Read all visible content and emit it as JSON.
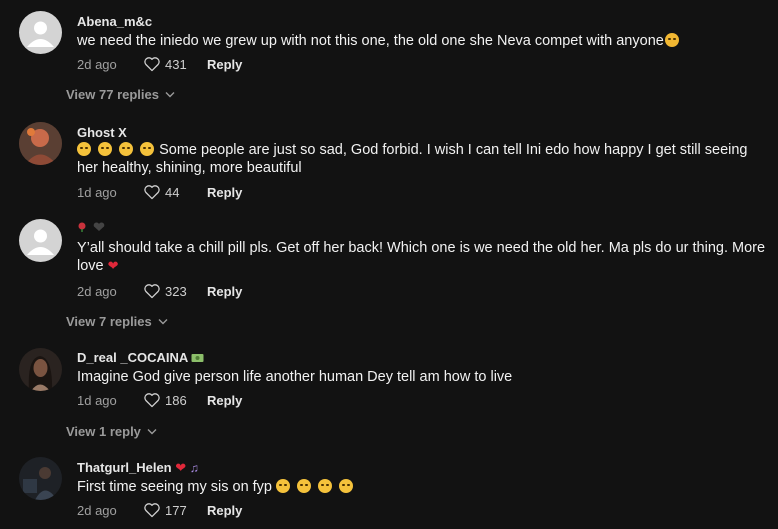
{
  "comments": [
    {
      "username": "Abena_m&c",
      "text": "we need the iniedo we grew up with not this one, the old one she Neva compet with anyone",
      "ago": "2d ago",
      "likes": "431",
      "reply": "Reply",
      "view_replies": "View 77 replies"
    },
    {
      "username": "Ghost X",
      "text": "Some people are just so sad, God forbid. I wish I can tell Ini edo how happy I get still seeing her healthy, shining, more beautiful",
      "ago": "1d ago",
      "likes": "44",
      "reply": "Reply"
    },
    {
      "username": "",
      "text": "Y’all should take a chill pill pls. Get off her back! Which one is we need the old her. Ma pls do ur thing. More love",
      "ago": "2d ago",
      "likes": "323",
      "reply": "Reply",
      "view_replies": "View 7 replies"
    },
    {
      "username": "D_real _COCAINA",
      "text": "Imagine God give person life another human Dey tell am how to live",
      "ago": "1d ago",
      "likes": "186",
      "reply": "Reply",
      "view_replies": "View 1 reply"
    },
    {
      "username": "Thatgurl_Helen",
      "text": "First time seeing my sis on fyp",
      "ago": "2d ago",
      "likes": "177",
      "reply": "Reply"
    }
  ],
  "colors": {
    "background": "#121212",
    "accent_heart": "#e0283a",
    "default_avatar": "#d4d4d4"
  }
}
